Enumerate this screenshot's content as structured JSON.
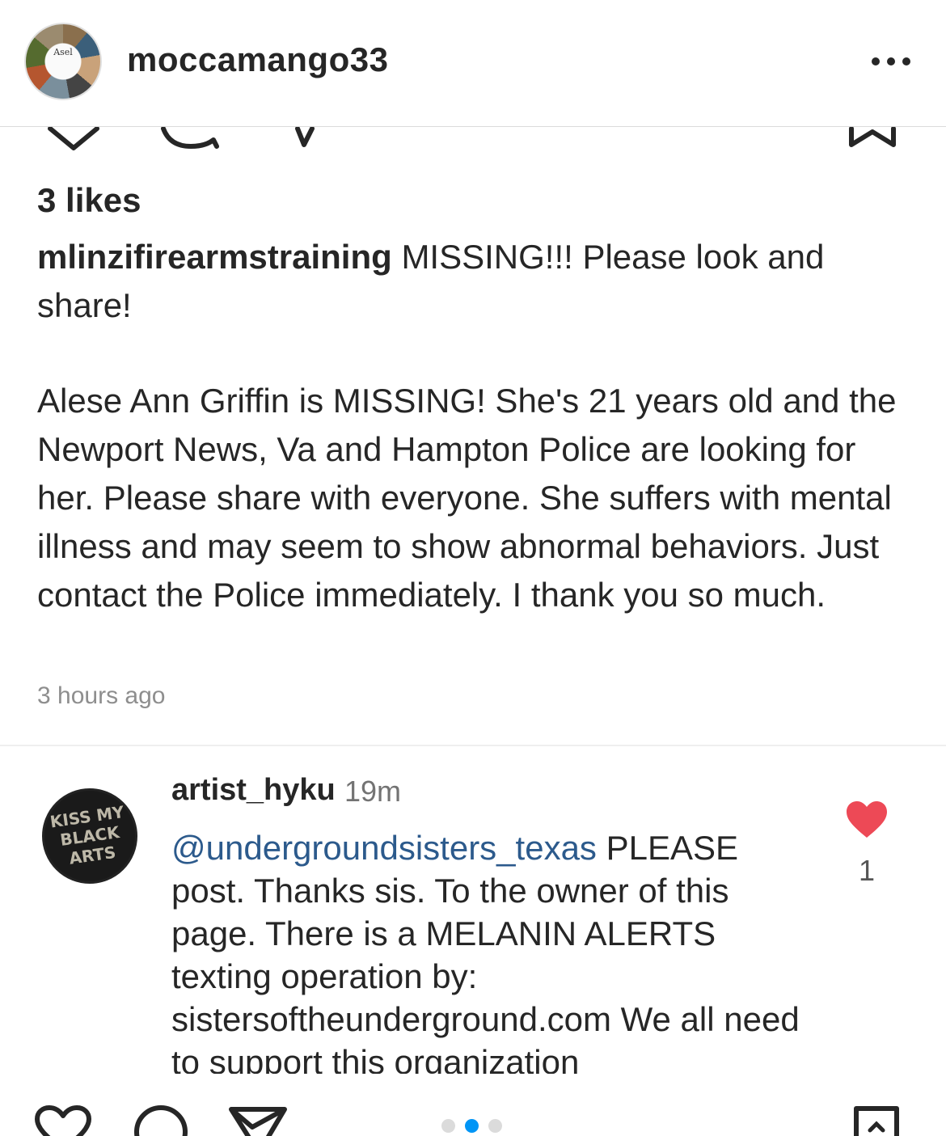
{
  "header": {
    "username": "moccamango33",
    "avatar_text": "Asel"
  },
  "post": {
    "likes": "3 likes",
    "caption_user": "mlinzifirearmstraining",
    "caption_line1": "MISSING!!! Please look and share!",
    "caption_body": "Alese Ann Griffin is MISSING! She's 21 years old and the Newport News, Va and Hampton Police are looking for her. Please share with everyone. She suffers with mental illness and may seem to show abnormal behaviors. Just contact the Police immediately. I thank you so much.",
    "time_ago": "3 hours ago"
  },
  "comment": {
    "username": "artist_hyku",
    "time": "19m",
    "avatar_text": "KISS MY BLACK ARTS",
    "mention": "@undergroundsisters_texas",
    "text": "PLEASE post. Thanks sis. To the owner of this page. There is a MELANIN ALERTS texting operation by: sistersoftheunderground.com  We all need to support this organization",
    "like_count": "1",
    "heart_color": "#ed4956"
  },
  "icons": {
    "top_row": [
      "heart-icon",
      "comment-icon",
      "share-icon",
      "bookmark-icon"
    ],
    "bottom_row": [
      "heart-icon",
      "comment-icon",
      "share-icon",
      "bookmark-icon"
    ]
  },
  "carousel": {
    "total": 3,
    "active_index": 1,
    "active_color": "#0095f6"
  }
}
